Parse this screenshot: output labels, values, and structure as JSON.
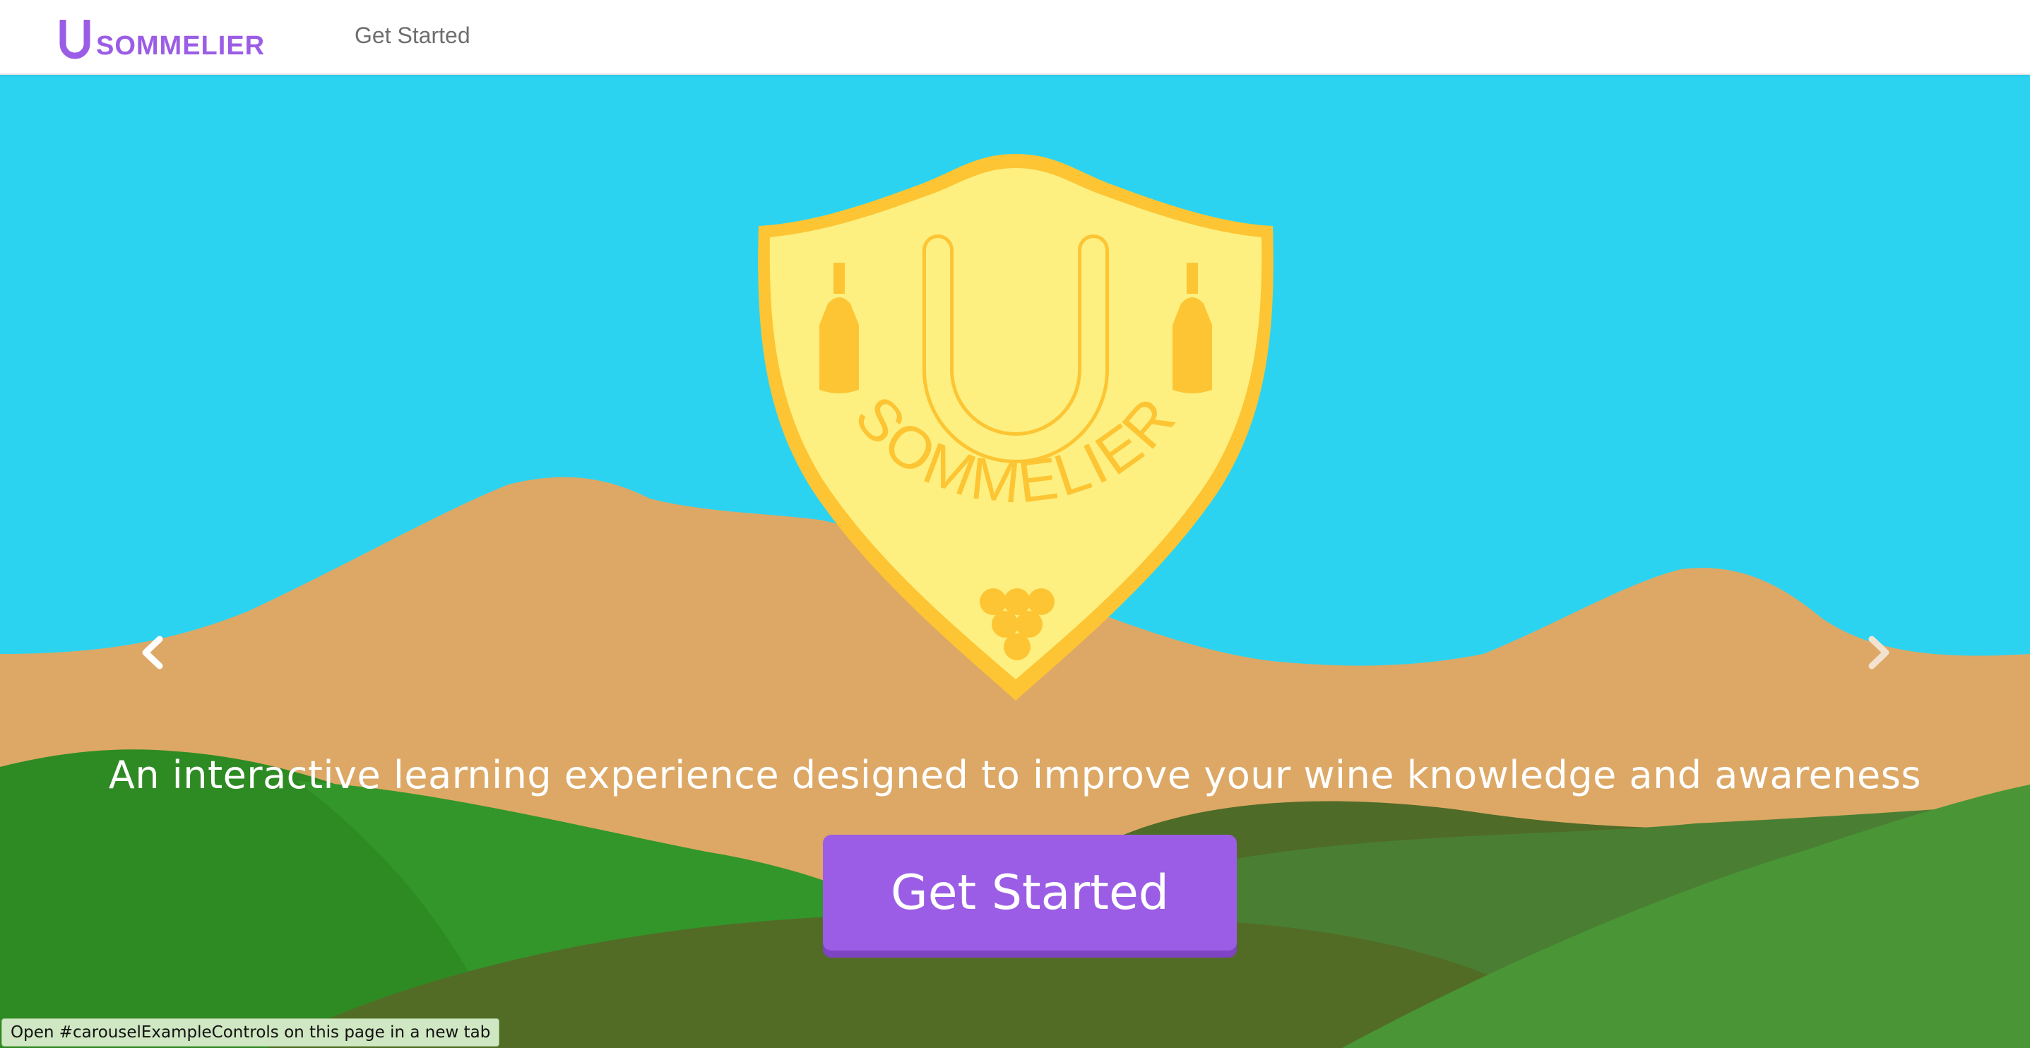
{
  "navbar": {
    "brand_letter": "U",
    "brand_text": "SOMMELIER",
    "nav_link": "Get Started"
  },
  "hero": {
    "crest_letter": "U",
    "crest_text": "SOMMELIER",
    "tagline": "An interactive learning experience designed to improve your wine knowledge and awareness",
    "cta_label": "Get Started",
    "prev_icon": "chevron-left-icon",
    "next_icon": "chevron-right-icon"
  },
  "status_bar": {
    "text": "Open #carouselExampleControls on this page in a new tab"
  },
  "colors": {
    "brand": "#9b5de5",
    "sky": "#2cd3f1",
    "mountain": "#dda865",
    "crest_fill": "#fdf081",
    "crest_stroke": "#fdc533",
    "hill_dark": "#2e8b23",
    "hill_olive": "#4f6b28"
  }
}
